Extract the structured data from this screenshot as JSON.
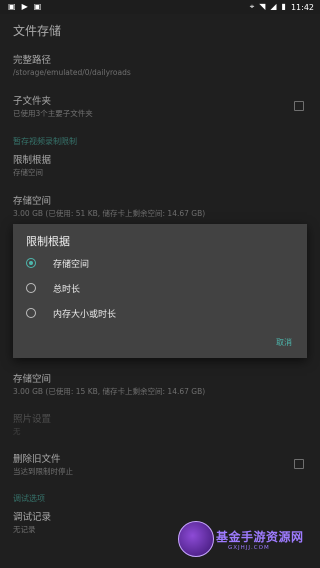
{
  "status_bar": {
    "left_icons": [
      "notification-icon",
      "play-icon",
      "notification-icon"
    ],
    "right_icons": [
      "location-icon",
      "wifi-icon",
      "signal-icon",
      "battery-icon"
    ],
    "time": "11:42"
  },
  "app_bar": {
    "title": "文件存储"
  },
  "prefs": {
    "full_path": {
      "title": "完整路径",
      "summary": "/storage/emulated/0/dailyroads"
    },
    "subfolder": {
      "title": "子文件夹",
      "summary": "已使用3个主要子文件夹"
    },
    "category_limit": "暂存视频录制限制",
    "limit_by": {
      "title": "限制根据",
      "summary": "存储空间"
    },
    "storage_top": {
      "title": "存储空间",
      "summary": "3.00 GB (已使用: 51 KB, 储存卡上剩余空间: 14.67 GB)"
    },
    "storage_bottom": {
      "title": "存储空间",
      "summary": "3.00 GB (已使用: 15 KB, 储存卡上剩余空间: 14.67 GB)"
    },
    "photo_settings": {
      "title": "照片设置",
      "summary": "无"
    },
    "delete_old": {
      "title": "删除旧文件",
      "summary": "当达到限制时停止"
    },
    "category_debug": "调试选项",
    "debug_log": {
      "title": "调试记录",
      "summary": "无记录"
    }
  },
  "dialog": {
    "title": "限制根据",
    "options": [
      {
        "label": "存储空间",
        "selected": true
      },
      {
        "label": "总时长",
        "selected": false
      },
      {
        "label": "内存大小或时长",
        "selected": false
      }
    ],
    "cancel": "取消"
  },
  "colors": {
    "accent": "#4db6ac",
    "background": "#2b2b2b",
    "dialog": "#424242"
  },
  "watermark": {
    "text": "基金手游资源网",
    "sub": "GXJHJJ.COM"
  }
}
